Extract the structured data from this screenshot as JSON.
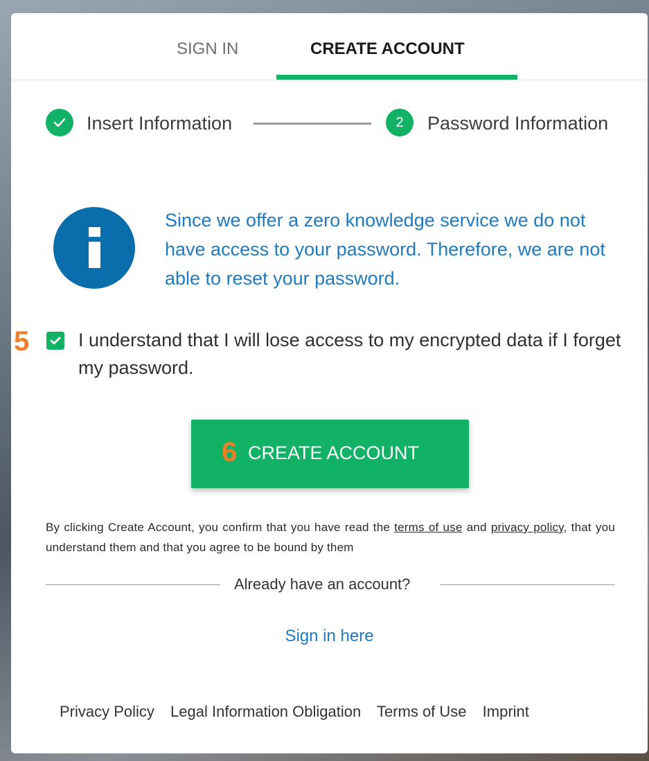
{
  "tabs": {
    "sign_in": "SIGN IN",
    "create_account": "CREATE ACCOUNT"
  },
  "stepper": {
    "step1": {
      "label": "Insert Information",
      "status": "complete"
    },
    "step2": {
      "number": "2",
      "label": "Password Information",
      "status": "active"
    }
  },
  "info": {
    "message": "Since we offer a zero knowledge service we do not have access to your password. Therefore, we are not able to reset your password."
  },
  "consent": {
    "marker": "5",
    "checked": true,
    "text": "I understand that I will lose access to my encrypted data if I forget my password."
  },
  "create_button": {
    "marker": "6",
    "label": "CREATE ACCOUNT"
  },
  "terms": {
    "prefix": "By clicking Create Account, you confirm that you have read the",
    "terms_link": "terms of use",
    "and": "and",
    "privacy_link": "privacy policy",
    "suffix": ", that you understand them and that you agree to be bound by them"
  },
  "divider": {
    "text": "Already have an account?"
  },
  "sign_in_link": "Sign in here",
  "footer": {
    "links": [
      "Privacy Policy",
      "Legal Information Obligation",
      "Terms of Use",
      "Imprint"
    ]
  },
  "colors": {
    "accent_green": "#12b266",
    "info_blue": "#0b6eac",
    "link_blue": "#1f7bc1",
    "annotation_orange": "#f07e26"
  }
}
